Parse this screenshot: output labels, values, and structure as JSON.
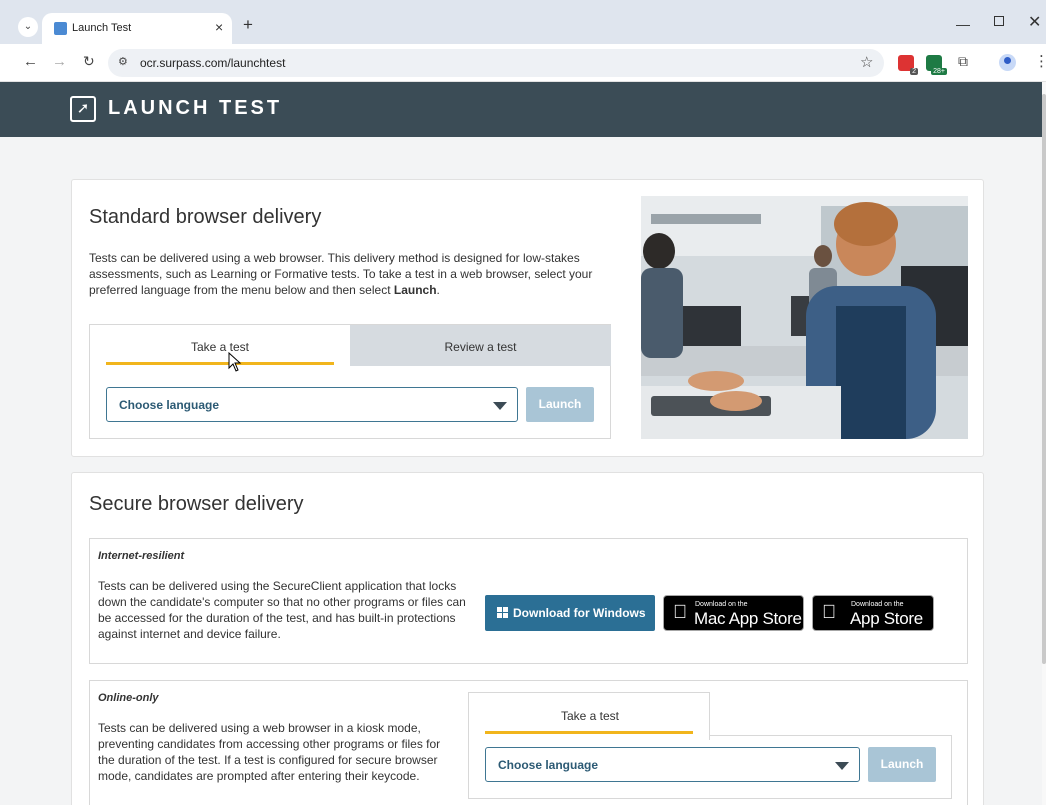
{
  "browser": {
    "tab_title": "Launch Test",
    "url": "ocr.surpass.com/launchtest",
    "ext_badge_1": "2",
    "ext_badge_2": "28+",
    "icons": [
      "tab-search-icon",
      "favicon-icon",
      "close-icon",
      "plus-icon",
      "minimize-icon",
      "maximize-icon",
      "window-close-icon",
      "back-icon",
      "forward-icon",
      "reload-icon",
      "site-settings-icon",
      "star-icon",
      "extension-icon",
      "puzzle-icon",
      "profile-icon",
      "menu-icon"
    ]
  },
  "header": {
    "title": "LAUNCH TEST",
    "bg_color": "#3b4c56",
    "icon": "rocket-icon"
  },
  "standard": {
    "title": "Standard browser delivery",
    "desc_1": "Tests can be delivered using a web browser. This delivery method is designed for low-stakes assessments, such as Learning or Formative tests. To take a test in a web browser, select your preferred language from the menu below and then select ",
    "desc_bold": "Launch",
    "desc_end": ".",
    "tab_take": "Take a test",
    "tab_review": "Review a test",
    "language_placeholder": "Choose language",
    "launch_label": "Launch",
    "accent_color": "#f1b51c"
  },
  "secure": {
    "title": "Secure browser delivery",
    "internet_resilient": {
      "title": "Internet-resilient",
      "desc": "Tests can be delivered using the SecureClient application that locks down the candidate's computer so that no other programs or files can be accessed for the duration of the test, and has built-in protections against internet and device failure.",
      "windows_label": "Download for Windows",
      "mac_small": "Download on the",
      "mac_big": "Mac App Store",
      "ios_small": "Download on the",
      "ios_big": "App Store"
    },
    "online_only": {
      "title": "Online-only",
      "desc": "Tests can be delivered using a web browser in a kiosk mode, preventing candidates from accessing other programs or files for the duration of the test. If a test is configured for secure browser mode, candidates are prompted after entering their keycode.",
      "tab_take": "Take a test",
      "language_placeholder": "Choose language",
      "launch_label": "Launch"
    }
  }
}
